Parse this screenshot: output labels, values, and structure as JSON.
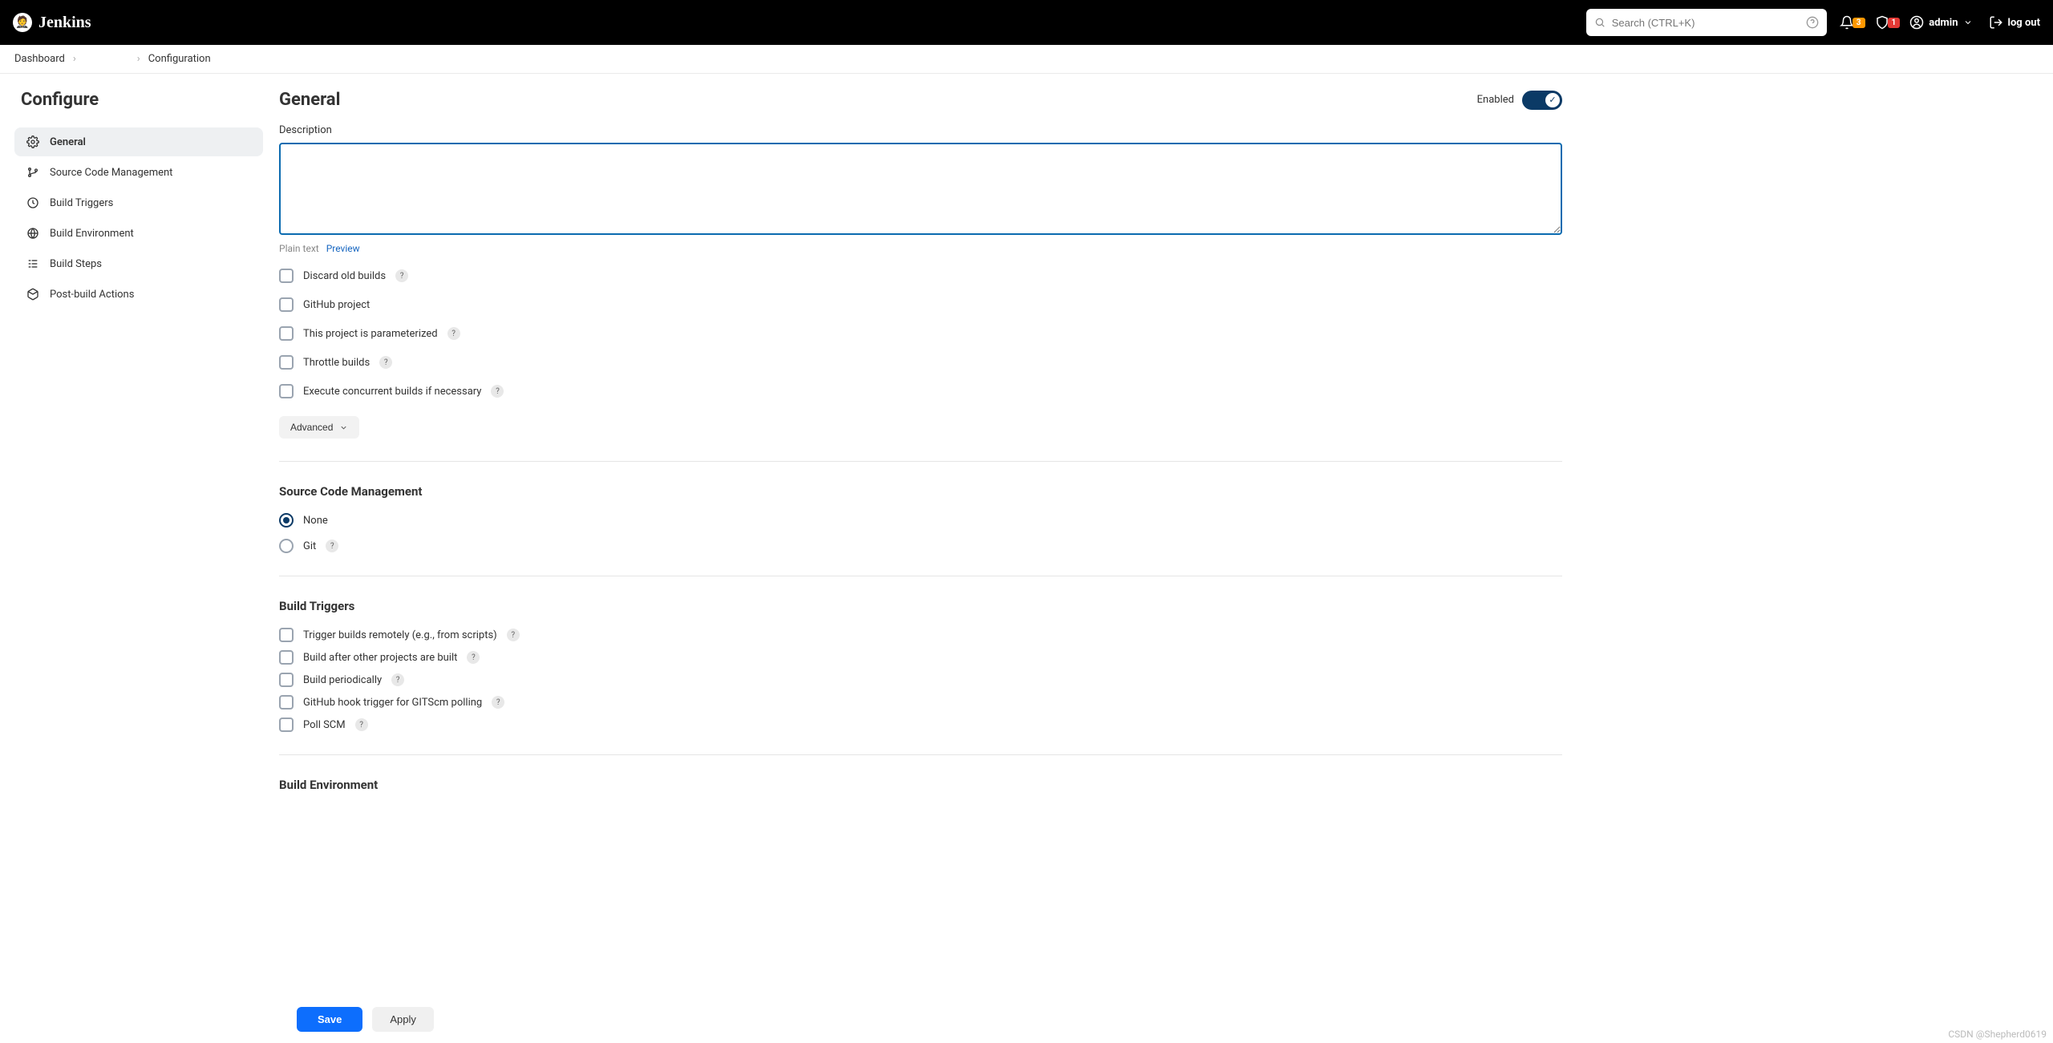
{
  "header": {
    "brand": "Jenkins",
    "search_placeholder": "Search (CTRL+K)",
    "notif_badge": "3",
    "security_badge": "1",
    "username": "admin",
    "logout": "log out"
  },
  "breadcrumbs": {
    "items": [
      "Dashboard",
      "",
      "Configuration"
    ]
  },
  "sidebar": {
    "title": "Configure",
    "items": [
      {
        "label": "General"
      },
      {
        "label": "Source Code Management"
      },
      {
        "label": "Build Triggers"
      },
      {
        "label": "Build Environment"
      },
      {
        "label": "Build Steps"
      },
      {
        "label": "Post-build Actions"
      }
    ]
  },
  "general": {
    "title": "General",
    "toggle_label": "Enabled",
    "description_label": "Description",
    "plain_text": "Plain text",
    "preview": "Preview",
    "opts": {
      "discard": "Discard old builds",
      "github": "GitHub project",
      "param": "This project is parameterized",
      "throttle": "Throttle builds",
      "concurrent": "Execute concurrent builds if necessary"
    },
    "advanced": "Advanced"
  },
  "scm": {
    "title": "Source Code Management",
    "none": "None",
    "git": "Git"
  },
  "triggers": {
    "title": "Build Triggers",
    "remote": "Trigger builds remotely (e.g., from scripts)",
    "after": "Build after other projects are built",
    "periodic": "Build periodically",
    "githook": "GitHub hook trigger for GITScm polling",
    "poll": "Poll SCM"
  },
  "env": {
    "title": "Build Environment"
  },
  "buttons": {
    "save": "Save",
    "apply": "Apply"
  },
  "watermark": "CSDN @Shepherd0619"
}
